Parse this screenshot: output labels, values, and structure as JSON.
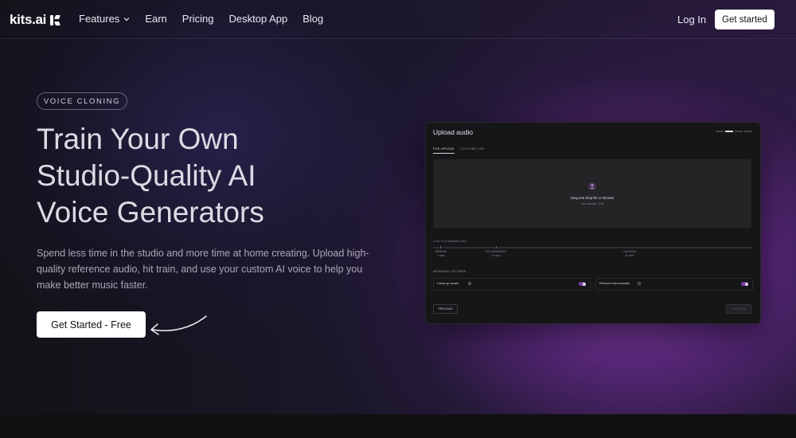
{
  "nav": {
    "logo_text": "kits.ai",
    "items": [
      {
        "label": "Features",
        "has_dropdown": true
      },
      {
        "label": "Earn"
      },
      {
        "label": "Pricing"
      },
      {
        "label": "Desktop App"
      },
      {
        "label": "Blog"
      }
    ],
    "login_label": "Log In",
    "get_started_label": "Get started"
  },
  "hero": {
    "tag": "VOICE CLONING",
    "title_lines": [
      "Train Your Own",
      "Studio-Quality AI",
      "Voice Generators"
    ],
    "subtitle": "Spend less time in the studio and more time at home creating.  Upload high-quality reference audio, hit train, and use your custom AI voice to help you make better music faster.",
    "cta_label": "Get Started - Free"
  },
  "mockup": {
    "title": "Upload audio",
    "tabs": [
      "FILE UPLOAD",
      "YOUTUBE LINK"
    ],
    "dropzone": {
      "text": "Drag and drop file or Browse",
      "subtext": "Max dataset: 1GB"
    },
    "usage_text": "0 out of 10 minutes used",
    "usage_fraction": 0.0,
    "markers": [
      {
        "label": "MINIMUM",
        "value": "2 mins"
      },
      {
        "label": "RECOMMENDED",
        "value": "10 mins"
      },
      {
        "label": "MAXIMUM",
        "value": "40 mins"
      }
    ],
    "advanced_label": "ADVANCED SETTINGS",
    "options": [
      {
        "label": "Clean up vocals",
        "enabled": true
      },
      {
        "label": "Remove Instrumentals",
        "enabled": true
      }
    ],
    "prev_label": "PREVIOUS",
    "next_label": "CONTINUE"
  },
  "colors": {
    "accent": "#7a3fa0",
    "background": "#121016",
    "glow": "#9646be"
  }
}
